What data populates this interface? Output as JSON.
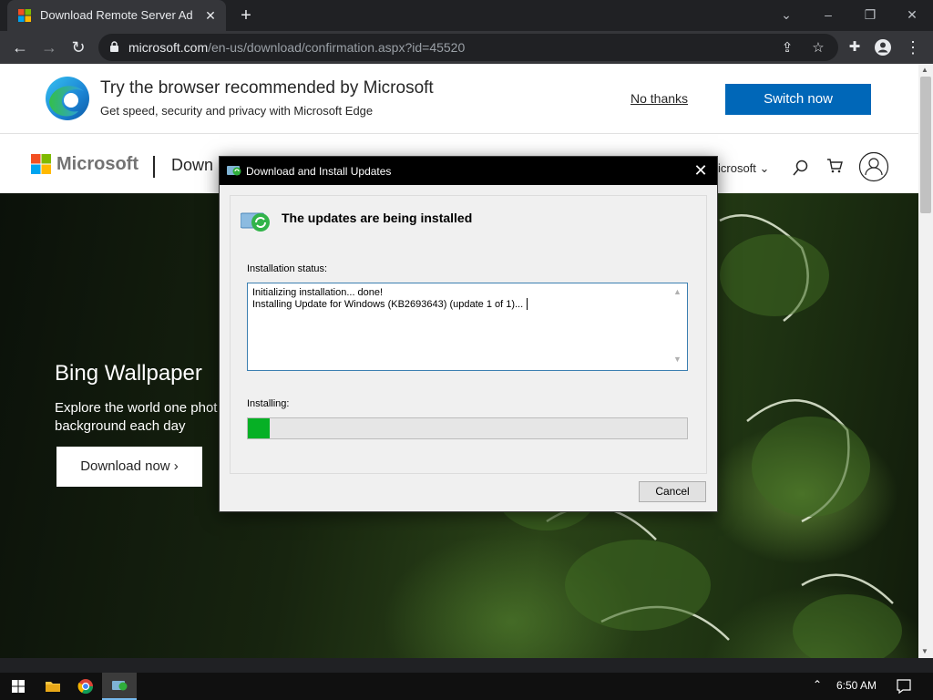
{
  "browser": {
    "tab": {
      "title": "Download Remote Server Administration Tools for Windows"
    },
    "url": {
      "host": "microsoft.com",
      "path": "/en-us/download/confirmation.aspx?id=45520"
    }
  },
  "edge_banner": {
    "title": "Try the browser recommended by Microsoft",
    "subtitle": "Get speed, security and privacy with Microsoft Edge",
    "no_thanks": "No thanks",
    "switch_now": "Switch now"
  },
  "ms_header": {
    "logo_text": "Microsoft",
    "site_title": "Down",
    "all_microsoft": "icrosoft ⌄"
  },
  "hero": {
    "title": "Bing Wallpaper",
    "text": "Explore the world one phot background each day",
    "button": "Download now ›"
  },
  "dialog": {
    "title": "Download and Install Updates",
    "heading": "The updates are being installed",
    "status_label": "Installation status:",
    "status_lines": [
      "Initializing installation... done!",
      "Installing Update for Windows (KB2693643) (update 1 of 1)..."
    ],
    "installing_label": "Installing:",
    "progress_fraction": 0.05,
    "progress_color": "#06b025",
    "cancel": "Cancel"
  },
  "taskbar": {
    "time": "6:50 AM",
    "active_app_icon": "update-installer-icon"
  },
  "colors": {
    "accent": "#0067b8",
    "dialog_titlebar": "#000000"
  }
}
